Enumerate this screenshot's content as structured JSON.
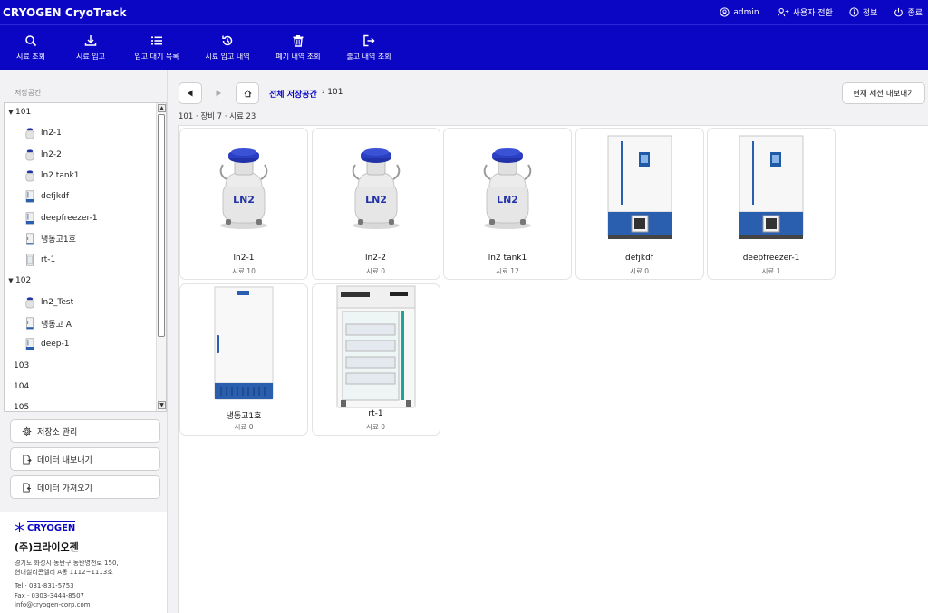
{
  "header": {
    "app_title": "CRYOGEN CryoTrack",
    "user": "admin",
    "switch_user": "사용자 전환",
    "info": "정보",
    "exit": "종료"
  },
  "toolbar": {
    "items": [
      {
        "label": "시료 조회",
        "icon": "search-icon"
      },
      {
        "label": "시료 입고",
        "icon": "download-icon"
      },
      {
        "label": "입고 대기 목록",
        "icon": "list-icon"
      },
      {
        "label": "시료 입고 내역",
        "icon": "history-icon"
      },
      {
        "label": "폐기 내역 조회",
        "icon": "trash-icon"
      },
      {
        "label": "출고 내역 조회",
        "icon": "logout-icon"
      }
    ]
  },
  "sidebar": {
    "title": "저장공간",
    "tree": [
      {
        "label": "101",
        "level": 0,
        "expanded": true
      },
      {
        "label": "ln2-1",
        "level": 1,
        "icon": "ln2-tank-icon"
      },
      {
        "label": "ln2-2",
        "level": 1,
        "icon": "ln2-tank-icon"
      },
      {
        "label": "ln2 tank1",
        "level": 1,
        "icon": "ln2-tank-icon"
      },
      {
        "label": "defjkdf",
        "level": 1,
        "icon": "deep-freezer-icon"
      },
      {
        "label": "deepfreezer-1",
        "level": 1,
        "icon": "deep-freezer-icon"
      },
      {
        "label": "냉동고1호",
        "level": 1,
        "icon": "freezer-icon"
      },
      {
        "label": "rt-1",
        "level": 1,
        "icon": "cabinet-icon"
      },
      {
        "label": "102",
        "level": 0,
        "expanded": true
      },
      {
        "label": "ln2_Test",
        "level": 1,
        "icon": "ln2-tank-icon"
      },
      {
        "label": "냉동고 A",
        "level": 1,
        "icon": "freezer-icon"
      },
      {
        "label": "deep-1",
        "level": 1,
        "icon": "deep-freezer-icon"
      },
      {
        "label": "103",
        "level": 0,
        "expanded": false
      },
      {
        "label": "104",
        "level": 0,
        "expanded": false
      },
      {
        "label": "105",
        "level": 0,
        "expanded": false
      }
    ],
    "buttons": [
      {
        "label": "저장소 관리",
        "icon": "gear-icon"
      },
      {
        "label": "데이터 내보내기",
        "icon": "export-file-icon"
      },
      {
        "label": "데이터 가져오기",
        "icon": "import-file-icon"
      }
    ]
  },
  "company": {
    "logo_text": "CRYOGEN",
    "name": "(주)크라이오젠",
    "address_line1": "경기도 화성시 동탄구 동탄영천로 150,",
    "address_line2": "현대실리콘앨리 A동 1112~1113호",
    "tel": "Tel · 031-831-5753",
    "fax": "Fax · 0303-3444-8507",
    "email": "info@cryogen-corp.com"
  },
  "main": {
    "breadcrumb_root": "전체 저장공간",
    "breadcrumb_current": "› 101",
    "export_session": "현재 세션 내보내기",
    "summary": "101 · 장비 7 · 시료 23",
    "devices": [
      {
        "name": "ln2-1",
        "count": "시료 10",
        "kind": "ln2"
      },
      {
        "name": "ln2-2",
        "count": "시료 0",
        "kind": "ln2"
      },
      {
        "name": "ln2 tank1",
        "count": "시료 12",
        "kind": "ln2"
      },
      {
        "name": "defjkdf",
        "count": "시료 0",
        "kind": "deep"
      },
      {
        "name": "deepfreezer-1",
        "count": "시료 1",
        "kind": "deep"
      },
      {
        "name": "냉동고1호",
        "count": "시료 0",
        "kind": "freezer"
      },
      {
        "name": "rt-1",
        "count": "시료 0",
        "kind": "cabinet"
      }
    ]
  },
  "colors": {
    "brand": "#0b06c4",
    "ln2_lid": "#2233a8",
    "freezer_blue": "#2a5fb0"
  }
}
